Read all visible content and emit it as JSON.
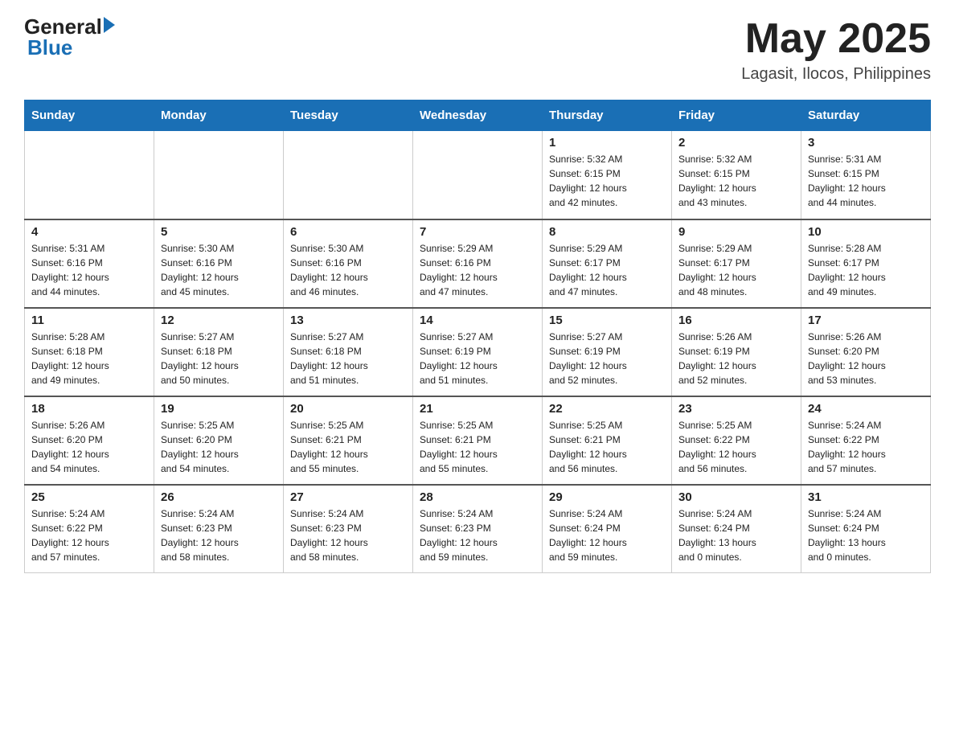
{
  "header": {
    "logo_text_general": "General",
    "logo_text_blue": "Blue",
    "month": "May 2025",
    "location": "Lagasit, Ilocos, Philippines"
  },
  "weekdays": [
    "Sunday",
    "Monday",
    "Tuesday",
    "Wednesday",
    "Thursday",
    "Friday",
    "Saturday"
  ],
  "weeks": [
    [
      {
        "day": "",
        "info": ""
      },
      {
        "day": "",
        "info": ""
      },
      {
        "day": "",
        "info": ""
      },
      {
        "day": "",
        "info": ""
      },
      {
        "day": "1",
        "info": "Sunrise: 5:32 AM\nSunset: 6:15 PM\nDaylight: 12 hours\nand 42 minutes."
      },
      {
        "day": "2",
        "info": "Sunrise: 5:32 AM\nSunset: 6:15 PM\nDaylight: 12 hours\nand 43 minutes."
      },
      {
        "day": "3",
        "info": "Sunrise: 5:31 AM\nSunset: 6:15 PM\nDaylight: 12 hours\nand 44 minutes."
      }
    ],
    [
      {
        "day": "4",
        "info": "Sunrise: 5:31 AM\nSunset: 6:16 PM\nDaylight: 12 hours\nand 44 minutes."
      },
      {
        "day": "5",
        "info": "Sunrise: 5:30 AM\nSunset: 6:16 PM\nDaylight: 12 hours\nand 45 minutes."
      },
      {
        "day": "6",
        "info": "Sunrise: 5:30 AM\nSunset: 6:16 PM\nDaylight: 12 hours\nand 46 minutes."
      },
      {
        "day": "7",
        "info": "Sunrise: 5:29 AM\nSunset: 6:16 PM\nDaylight: 12 hours\nand 47 minutes."
      },
      {
        "day": "8",
        "info": "Sunrise: 5:29 AM\nSunset: 6:17 PM\nDaylight: 12 hours\nand 47 minutes."
      },
      {
        "day": "9",
        "info": "Sunrise: 5:29 AM\nSunset: 6:17 PM\nDaylight: 12 hours\nand 48 minutes."
      },
      {
        "day": "10",
        "info": "Sunrise: 5:28 AM\nSunset: 6:17 PM\nDaylight: 12 hours\nand 49 minutes."
      }
    ],
    [
      {
        "day": "11",
        "info": "Sunrise: 5:28 AM\nSunset: 6:18 PM\nDaylight: 12 hours\nand 49 minutes."
      },
      {
        "day": "12",
        "info": "Sunrise: 5:27 AM\nSunset: 6:18 PM\nDaylight: 12 hours\nand 50 minutes."
      },
      {
        "day": "13",
        "info": "Sunrise: 5:27 AM\nSunset: 6:18 PM\nDaylight: 12 hours\nand 51 minutes."
      },
      {
        "day": "14",
        "info": "Sunrise: 5:27 AM\nSunset: 6:19 PM\nDaylight: 12 hours\nand 51 minutes."
      },
      {
        "day": "15",
        "info": "Sunrise: 5:27 AM\nSunset: 6:19 PM\nDaylight: 12 hours\nand 52 minutes."
      },
      {
        "day": "16",
        "info": "Sunrise: 5:26 AM\nSunset: 6:19 PM\nDaylight: 12 hours\nand 52 minutes."
      },
      {
        "day": "17",
        "info": "Sunrise: 5:26 AM\nSunset: 6:20 PM\nDaylight: 12 hours\nand 53 minutes."
      }
    ],
    [
      {
        "day": "18",
        "info": "Sunrise: 5:26 AM\nSunset: 6:20 PM\nDaylight: 12 hours\nand 54 minutes."
      },
      {
        "day": "19",
        "info": "Sunrise: 5:25 AM\nSunset: 6:20 PM\nDaylight: 12 hours\nand 54 minutes."
      },
      {
        "day": "20",
        "info": "Sunrise: 5:25 AM\nSunset: 6:21 PM\nDaylight: 12 hours\nand 55 minutes."
      },
      {
        "day": "21",
        "info": "Sunrise: 5:25 AM\nSunset: 6:21 PM\nDaylight: 12 hours\nand 55 minutes."
      },
      {
        "day": "22",
        "info": "Sunrise: 5:25 AM\nSunset: 6:21 PM\nDaylight: 12 hours\nand 56 minutes."
      },
      {
        "day": "23",
        "info": "Sunrise: 5:25 AM\nSunset: 6:22 PM\nDaylight: 12 hours\nand 56 minutes."
      },
      {
        "day": "24",
        "info": "Sunrise: 5:24 AM\nSunset: 6:22 PM\nDaylight: 12 hours\nand 57 minutes."
      }
    ],
    [
      {
        "day": "25",
        "info": "Sunrise: 5:24 AM\nSunset: 6:22 PM\nDaylight: 12 hours\nand 57 minutes."
      },
      {
        "day": "26",
        "info": "Sunrise: 5:24 AM\nSunset: 6:23 PM\nDaylight: 12 hours\nand 58 minutes."
      },
      {
        "day": "27",
        "info": "Sunrise: 5:24 AM\nSunset: 6:23 PM\nDaylight: 12 hours\nand 58 minutes."
      },
      {
        "day": "28",
        "info": "Sunrise: 5:24 AM\nSunset: 6:23 PM\nDaylight: 12 hours\nand 59 minutes."
      },
      {
        "day": "29",
        "info": "Sunrise: 5:24 AM\nSunset: 6:24 PM\nDaylight: 12 hours\nand 59 minutes."
      },
      {
        "day": "30",
        "info": "Sunrise: 5:24 AM\nSunset: 6:24 PM\nDaylight: 13 hours\nand 0 minutes."
      },
      {
        "day": "31",
        "info": "Sunrise: 5:24 AM\nSunset: 6:24 PM\nDaylight: 13 hours\nand 0 minutes."
      }
    ]
  ]
}
